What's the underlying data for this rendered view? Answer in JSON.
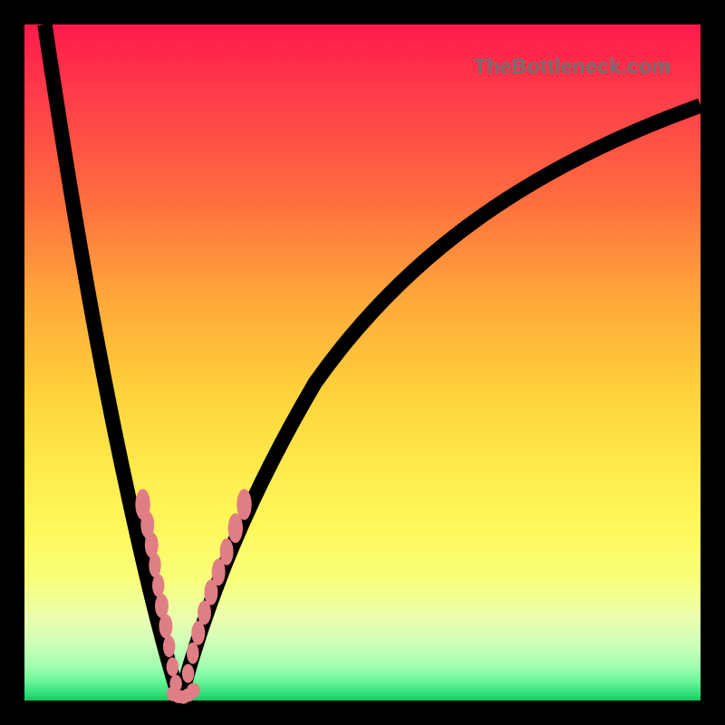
{
  "watermark": "TheBottleneck.com",
  "colors": {
    "gradient_top": "#ff1a4b",
    "gradient_mid": "#ffe94a",
    "gradient_bottom": "#14c75e",
    "frame": "#000000",
    "curve": "#000000",
    "marker": "#e07e85"
  },
  "chart_data": {
    "type": "line",
    "title": "",
    "xlabel": "",
    "ylabel": "",
    "xlim": [
      0,
      100
    ],
    "ylim": [
      0,
      100
    ],
    "grid": false,
    "note": "Two convex decreasing/increasing curves forming a V with minimum near x≈23. Background color encodes value from red (high/bad) to green (low/good). Pink markers cluster where y is near 0 (≈green band) around x≈18–30.",
    "series": [
      {
        "name": "curve-left",
        "x": [
          3,
          5,
          7,
          9,
          11,
          13,
          15,
          17,
          19,
          21,
          22,
          23
        ],
        "y": [
          100,
          90,
          79,
          68,
          57,
          47,
          37,
          28,
          19,
          10,
          5,
          0
        ]
      },
      {
        "name": "curve-right",
        "x": [
          23,
          25,
          28,
          32,
          37,
          43,
          50,
          58,
          67,
          77,
          88,
          100
        ],
        "y": [
          0,
          6,
          14,
          24,
          34,
          44,
          53,
          62,
          70,
          77,
          83,
          88
        ]
      },
      {
        "name": "markers-left-branch",
        "kind": "scatter",
        "x": [
          17.5,
          18.0,
          18.7,
          19.2,
          19.6,
          20.1,
          20.7,
          21.2,
          21.7,
          22.2,
          22.6
        ],
        "y": [
          29,
          27,
          24,
          21,
          18,
          15,
          12,
          9,
          6,
          4,
          2
        ]
      },
      {
        "name": "markers-right-branch",
        "kind": "scatter",
        "x": [
          24.0,
          24.6,
          25.3,
          26.0,
          27.0,
          28.0,
          29.0,
          30.2,
          31.5
        ],
        "y": [
          3,
          5,
          7,
          9,
          12,
          15,
          18,
          22,
          26
        ]
      },
      {
        "name": "markers-floor",
        "kind": "scatter",
        "x": [
          21.8,
          22.5,
          23.0,
          23.6,
          24.3
        ],
        "y": [
          1,
          0.5,
          0,
          0.5,
          1
        ]
      }
    ]
  }
}
